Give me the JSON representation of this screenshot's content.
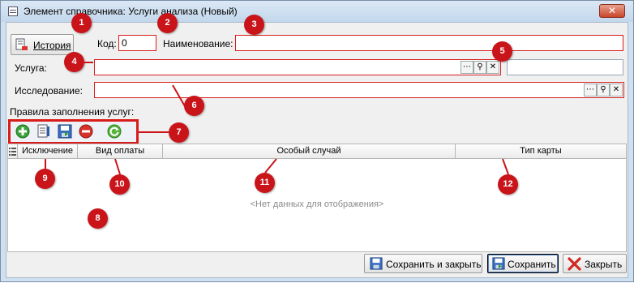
{
  "window": {
    "title": "Элемент справочника: Услуги анализа (Новый)",
    "close_glyph": "✕"
  },
  "toolbar_top": {
    "history_label": "История",
    "kod_label": "Код:",
    "kod_value": "0",
    "name_label": "Наименование:",
    "name_value": ""
  },
  "service": {
    "label": "Услуга:",
    "value": "",
    "extra_value": ""
  },
  "research": {
    "label": "Исследование:",
    "value": ""
  },
  "rules": {
    "label": "Правила заполнения услуг:"
  },
  "grid": {
    "columns": [
      "Исключение",
      "Вид оплаты",
      "Особый случай",
      "Тип карты"
    ],
    "empty_text": "<Нет данных для отображения>"
  },
  "footer": {
    "save_close_label": "Сохранить и закрыть",
    "save_label": "Сохранить",
    "close_label": "Закрыть"
  },
  "markers": [
    "1",
    "2",
    "3",
    "4",
    "5",
    "6",
    "7",
    "8",
    "9",
    "10",
    "11",
    "12"
  ],
  "icons": {
    "ellipsis": "⋯",
    "search": "⚲",
    "clear": "✕"
  },
  "colors": {
    "marker": "#c9141a",
    "field_border": "#d81c1c",
    "window_bg": "#cfe0f1"
  }
}
